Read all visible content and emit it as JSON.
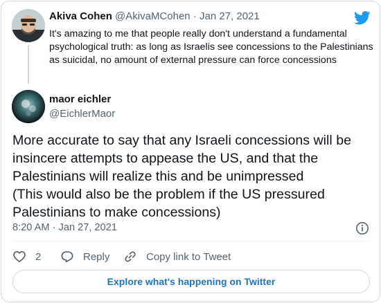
{
  "quoted": {
    "name": "Akiva Cohen",
    "handle": "@AkivaMCohen",
    "separator": "·",
    "date": "Jan 27, 2021",
    "text": "It's amazing to me that people really don't understand a fundamental psychological truth: as long as Israelis see concessions to the Palestinians as suicidal, no amount of external pressure can force concessions"
  },
  "author": {
    "name": "maor eichler",
    "handle": "@EichlerMaor"
  },
  "tweet": {
    "lines": [
      "More accurate to say that any Israeli concessions will be insincere attempts to appease the US, and that the Palestinians will realize this and be unimpressed",
      "(This would also be the problem if the US pressured Palestinians to make concessions)"
    ],
    "time": "8:20 AM",
    "separator": "·",
    "date": "Jan 27, 2021"
  },
  "actions": {
    "like_count": "2",
    "reply_label": "Reply",
    "copy_label": "Copy link to Tweet"
  },
  "explore_label": "Explore what's happening on Twitter",
  "colors": {
    "brand": "#1d9bf0",
    "link": "#1d74b8",
    "secondary_text": "#536471",
    "border": "#cfd9de"
  },
  "icons": [
    "twitter-bird-icon",
    "info-icon",
    "heart-icon",
    "reply-icon",
    "link-icon"
  ]
}
